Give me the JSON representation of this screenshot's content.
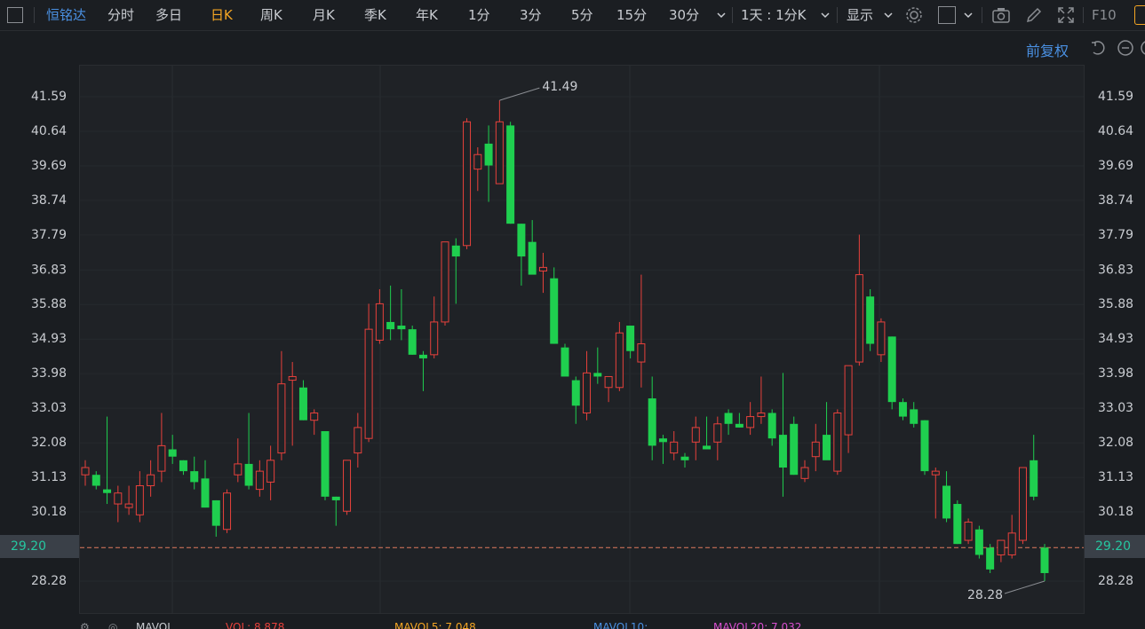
{
  "toolbar": {
    "stock_name": "恒铭达",
    "periods": [
      "分时",
      "多日",
      "日K",
      "周K",
      "月K",
      "季K",
      "年K",
      "1分",
      "3分",
      "5分",
      "15分",
      "30分"
    ],
    "active_period": "日K",
    "range_select": "1天 : 1分K",
    "display_label": "显示",
    "f10_label": "F10"
  },
  "subbar": {
    "restore_label": "前复权"
  },
  "axis": {
    "price_ticks": [
      "41.59",
      "40.64",
      "39.69",
      "38.74",
      "37.79",
      "36.83",
      "35.88",
      "34.93",
      "33.98",
      "33.03",
      "32.08",
      "31.13",
      "30.18",
      "28.28"
    ],
    "current_price": "29.20",
    "high_label": "41.49",
    "low_label": "28.28"
  },
  "colors": {
    "up": "#e8413c",
    "down": "#1fcf4f",
    "accent": "#f5a623",
    "brand": "#4a90e2",
    "price_tag": "#26c6a0"
  },
  "footer": {
    "mavol_label": "MAVOL",
    "vol": "VOL: 8.878",
    "ma5": "MAVOL5: 7.048",
    "ma10": "MAVOL10:",
    "ma20": "MAVOL20: 7.032"
  },
  "chart_data": {
    "type": "candlestick",
    "ylim": [
      27.7,
      42.2
    ],
    "candles": [
      {
        "o": 31.2,
        "h": 31.6,
        "l": 30.9,
        "c": 31.4
      },
      {
        "o": 31.2,
        "h": 31.3,
        "l": 30.8,
        "c": 30.9
      },
      {
        "o": 30.8,
        "h": 32.8,
        "l": 30.4,
        "c": 30.7
      },
      {
        "o": 30.4,
        "h": 30.9,
        "l": 29.9,
        "c": 30.7
      },
      {
        "o": 30.3,
        "h": 30.9,
        "l": 30.1,
        "c": 30.4
      },
      {
        "o": 30.1,
        "h": 31.3,
        "l": 29.9,
        "c": 30.9
      },
      {
        "o": 30.9,
        "h": 31.6,
        "l": 30.6,
        "c": 31.2
      },
      {
        "o": 31.3,
        "h": 32.9,
        "l": 31.0,
        "c": 32.0
      },
      {
        "o": 31.9,
        "h": 32.3,
        "l": 31.5,
        "c": 31.7
      },
      {
        "o": 31.6,
        "h": 31.6,
        "l": 31.2,
        "c": 31.3
      },
      {
        "o": 31.3,
        "h": 31.7,
        "l": 30.8,
        "c": 31.0
      },
      {
        "o": 31.1,
        "h": 31.6,
        "l": 30.3,
        "c": 30.3
      },
      {
        "o": 30.5,
        "h": 30.5,
        "l": 29.5,
        "c": 29.8
      },
      {
        "o": 29.7,
        "h": 30.8,
        "l": 29.6,
        "c": 30.7
      },
      {
        "o": 31.2,
        "h": 32.2,
        "l": 31.0,
        "c": 31.5
      },
      {
        "o": 31.5,
        "h": 32.9,
        "l": 30.8,
        "c": 30.9
      },
      {
        "o": 30.8,
        "h": 31.6,
        "l": 30.6,
        "c": 31.3
      },
      {
        "o": 31.0,
        "h": 32.0,
        "l": 30.5,
        "c": 31.6
      },
      {
        "o": 31.8,
        "h": 34.6,
        "l": 31.6,
        "c": 33.7
      },
      {
        "o": 33.8,
        "h": 34.3,
        "l": 32.0,
        "c": 33.9
      },
      {
        "o": 33.6,
        "h": 33.8,
        "l": 32.7,
        "c": 32.7
      },
      {
        "o": 32.7,
        "h": 33.0,
        "l": 32.3,
        "c": 32.9
      },
      {
        "o": 32.4,
        "h": 32.4,
        "l": 30.5,
        "c": 30.6
      },
      {
        "o": 30.6,
        "h": 30.6,
        "l": 29.8,
        "c": 30.5
      },
      {
        "o": 30.2,
        "h": 31.6,
        "l": 30.1,
        "c": 31.6
      },
      {
        "o": 31.8,
        "h": 32.9,
        "l": 31.4,
        "c": 32.5
      },
      {
        "o": 32.2,
        "h": 35.9,
        "l": 32.1,
        "c": 35.2
      },
      {
        "o": 34.9,
        "h": 36.3,
        "l": 34.8,
        "c": 35.9
      },
      {
        "o": 35.4,
        "h": 36.4,
        "l": 34.9,
        "c": 35.2
      },
      {
        "o": 35.3,
        "h": 36.3,
        "l": 34.9,
        "c": 35.2
      },
      {
        "o": 35.2,
        "h": 35.3,
        "l": 34.5,
        "c": 34.5
      },
      {
        "o": 34.5,
        "h": 34.6,
        "l": 33.5,
        "c": 34.4
      },
      {
        "o": 34.5,
        "h": 36.1,
        "l": 34.4,
        "c": 35.4
      },
      {
        "o": 35.4,
        "h": 37.6,
        "l": 35.3,
        "c": 37.6
      },
      {
        "o": 37.5,
        "h": 37.7,
        "l": 35.9,
        "c": 37.2
      },
      {
        "o": 37.5,
        "h": 41.0,
        "l": 37.4,
        "c": 40.9
      },
      {
        "o": 39.6,
        "h": 40.2,
        "l": 39.0,
        "c": 40.0
      },
      {
        "o": 40.3,
        "h": 40.8,
        "l": 38.7,
        "c": 39.7
      },
      {
        "o": 39.2,
        "h": 41.49,
        "l": 39.2,
        "c": 40.9
      },
      {
        "o": 40.8,
        "h": 40.9,
        "l": 38.1,
        "c": 38.1
      },
      {
        "o": 38.1,
        "h": 38.1,
        "l": 36.4,
        "c": 37.2
      },
      {
        "o": 37.6,
        "h": 38.2,
        "l": 36.8,
        "c": 36.7
      },
      {
        "o": 36.8,
        "h": 37.3,
        "l": 36.2,
        "c": 36.9
      },
      {
        "o": 36.6,
        "h": 36.9,
        "l": 34.8,
        "c": 34.8
      },
      {
        "o": 34.7,
        "h": 34.8,
        "l": 34.0,
        "c": 33.9
      },
      {
        "o": 33.8,
        "h": 33.9,
        "l": 32.6,
        "c": 33.1
      },
      {
        "o": 32.9,
        "h": 34.6,
        "l": 32.7,
        "c": 34.0
      },
      {
        "o": 34.0,
        "h": 34.7,
        "l": 33.7,
        "c": 33.9
      },
      {
        "o": 33.6,
        "h": 33.7,
        "l": 33.2,
        "c": 33.9
      },
      {
        "o": 33.6,
        "h": 35.4,
        "l": 33.5,
        "c": 35.1
      },
      {
        "o": 35.3,
        "h": 35.3,
        "l": 34.4,
        "c": 34.6
      },
      {
        "o": 34.3,
        "h": 36.7,
        "l": 33.6,
        "c": 34.8
      },
      {
        "o": 33.3,
        "h": 33.9,
        "l": 31.6,
        "c": 32.0
      },
      {
        "o": 32.2,
        "h": 32.3,
        "l": 31.5,
        "c": 32.1
      },
      {
        "o": 31.8,
        "h": 32.4,
        "l": 31.6,
        "c": 32.1
      },
      {
        "o": 31.7,
        "h": 31.8,
        "l": 31.4,
        "c": 31.6
      },
      {
        "o": 32.1,
        "h": 32.8,
        "l": 31.6,
        "c": 32.5
      },
      {
        "o": 32.0,
        "h": 32.8,
        "l": 31.9,
        "c": 31.9
      },
      {
        "o": 32.1,
        "h": 32.8,
        "l": 31.6,
        "c": 32.6
      },
      {
        "o": 32.9,
        "h": 33.0,
        "l": 32.3,
        "c": 32.6
      },
      {
        "o": 32.6,
        "h": 32.9,
        "l": 32.5,
        "c": 32.5
      },
      {
        "o": 32.5,
        "h": 33.2,
        "l": 32.3,
        "c": 32.8
      },
      {
        "o": 32.8,
        "h": 33.9,
        "l": 32.6,
        "c": 32.9
      },
      {
        "o": 32.9,
        "h": 33.0,
        "l": 32.0,
        "c": 32.2
      },
      {
        "o": 32.3,
        "h": 34.0,
        "l": 30.6,
        "c": 31.4
      },
      {
        "o": 32.6,
        "h": 32.8,
        "l": 31.2,
        "c": 31.2
      },
      {
        "o": 31.1,
        "h": 31.6,
        "l": 31.0,
        "c": 31.4
      },
      {
        "o": 31.7,
        "h": 32.6,
        "l": 31.3,
        "c": 32.1
      },
      {
        "o": 32.3,
        "h": 33.2,
        "l": 31.7,
        "c": 31.6
      },
      {
        "o": 31.3,
        "h": 33.0,
        "l": 31.2,
        "c": 32.9
      },
      {
        "o": 32.3,
        "h": 34.2,
        "l": 31.8,
        "c": 34.2
      },
      {
        "o": 34.3,
        "h": 37.8,
        "l": 34.2,
        "c": 36.7
      },
      {
        "o": 36.1,
        "h": 36.3,
        "l": 34.6,
        "c": 34.8
      },
      {
        "o": 34.5,
        "h": 35.5,
        "l": 34.3,
        "c": 35.4
      },
      {
        "o": 35.0,
        "h": 35.0,
        "l": 33.0,
        "c": 33.2
      },
      {
        "o": 33.2,
        "h": 33.3,
        "l": 32.7,
        "c": 32.8
      },
      {
        "o": 33.0,
        "h": 33.2,
        "l": 32.5,
        "c": 32.6
      },
      {
        "o": 32.7,
        "h": 32.7,
        "l": 31.2,
        "c": 31.3
      },
      {
        "o": 31.2,
        "h": 31.4,
        "l": 30.0,
        "c": 31.3
      },
      {
        "o": 30.9,
        "h": 31.3,
        "l": 29.9,
        "c": 30.0
      },
      {
        "o": 30.4,
        "h": 30.5,
        "l": 29.3,
        "c": 29.3
      },
      {
        "o": 29.4,
        "h": 30.0,
        "l": 29.3,
        "c": 29.9
      },
      {
        "o": 29.7,
        "h": 29.8,
        "l": 28.9,
        "c": 29.0
      },
      {
        "o": 29.2,
        "h": 29.3,
        "l": 28.5,
        "c": 28.6
      },
      {
        "o": 29.0,
        "h": 29.4,
        "l": 28.8,
        "c": 29.4
      },
      {
        "o": 29.0,
        "h": 30.1,
        "l": 28.9,
        "c": 29.6
      },
      {
        "o": 29.4,
        "h": 31.4,
        "l": 29.3,
        "c": 31.4
      },
      {
        "o": 31.6,
        "h": 32.3,
        "l": 30.5,
        "c": 30.6
      },
      {
        "o": 29.2,
        "h": 29.3,
        "l": 28.28,
        "c": 28.5
      }
    ]
  }
}
